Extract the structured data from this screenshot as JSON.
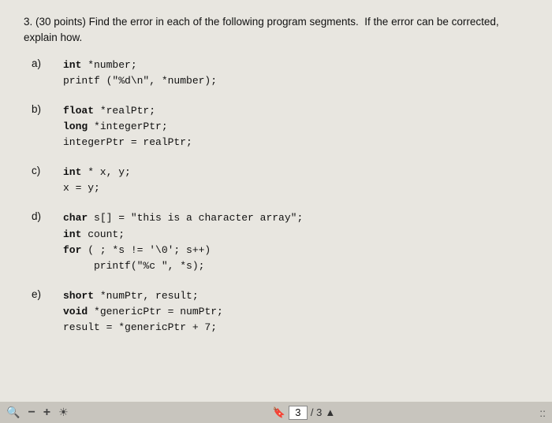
{
  "question": {
    "number": "3.",
    "points": "(30 points)",
    "text": "Find the error in each of the following program segments.",
    "instruction": "If the error can be corrected, explain how."
  },
  "parts": [
    {
      "label": "a)",
      "lines": [
        {
          "bold": "int",
          "rest": " *number;"
        },
        {
          "bold": "",
          "rest": "printf (\"%d\\n\", *number);"
        }
      ]
    },
    {
      "label": "b)",
      "lines": [
        {
          "bold": "float",
          "rest": " *realPtr;"
        },
        {
          "bold": "long",
          "rest": " *integerPtr;"
        },
        {
          "bold": "",
          "rest": "integerPtr = realPtr;"
        }
      ]
    },
    {
      "label": "c)",
      "lines": [
        {
          "bold": "int",
          "rest": " * x, y;"
        },
        {
          "bold": "",
          "rest": "x = y;"
        }
      ]
    },
    {
      "label": "d)",
      "lines": [
        {
          "bold": "char",
          "rest": " s[] = \"this is a character array\";"
        },
        {
          "bold": "int",
          "rest": " count;"
        },
        {
          "bold": "for",
          "rest": " ( ; *s != '\\0'; s++)"
        },
        {
          "bold": "",
          "rest": "     printf(\"%c \", *s);"
        }
      ]
    },
    {
      "label": "e)",
      "lines": [
        {
          "bold": "short",
          "rest": " *numPtr, result;"
        },
        {
          "bold": "void",
          "rest": " *genericPtr = numPtr;"
        },
        {
          "bold": "",
          "rest": "result = *genericPtr + 7;"
        }
      ]
    }
  ],
  "toolbar": {
    "search_icon": "🔍",
    "minus_label": "−",
    "plus_label": "+",
    "brightness_icon": "☀",
    "bookmark_icon": "🔖",
    "page_current": "3",
    "page_total": "/ 3",
    "menu_icon": "::"
  }
}
